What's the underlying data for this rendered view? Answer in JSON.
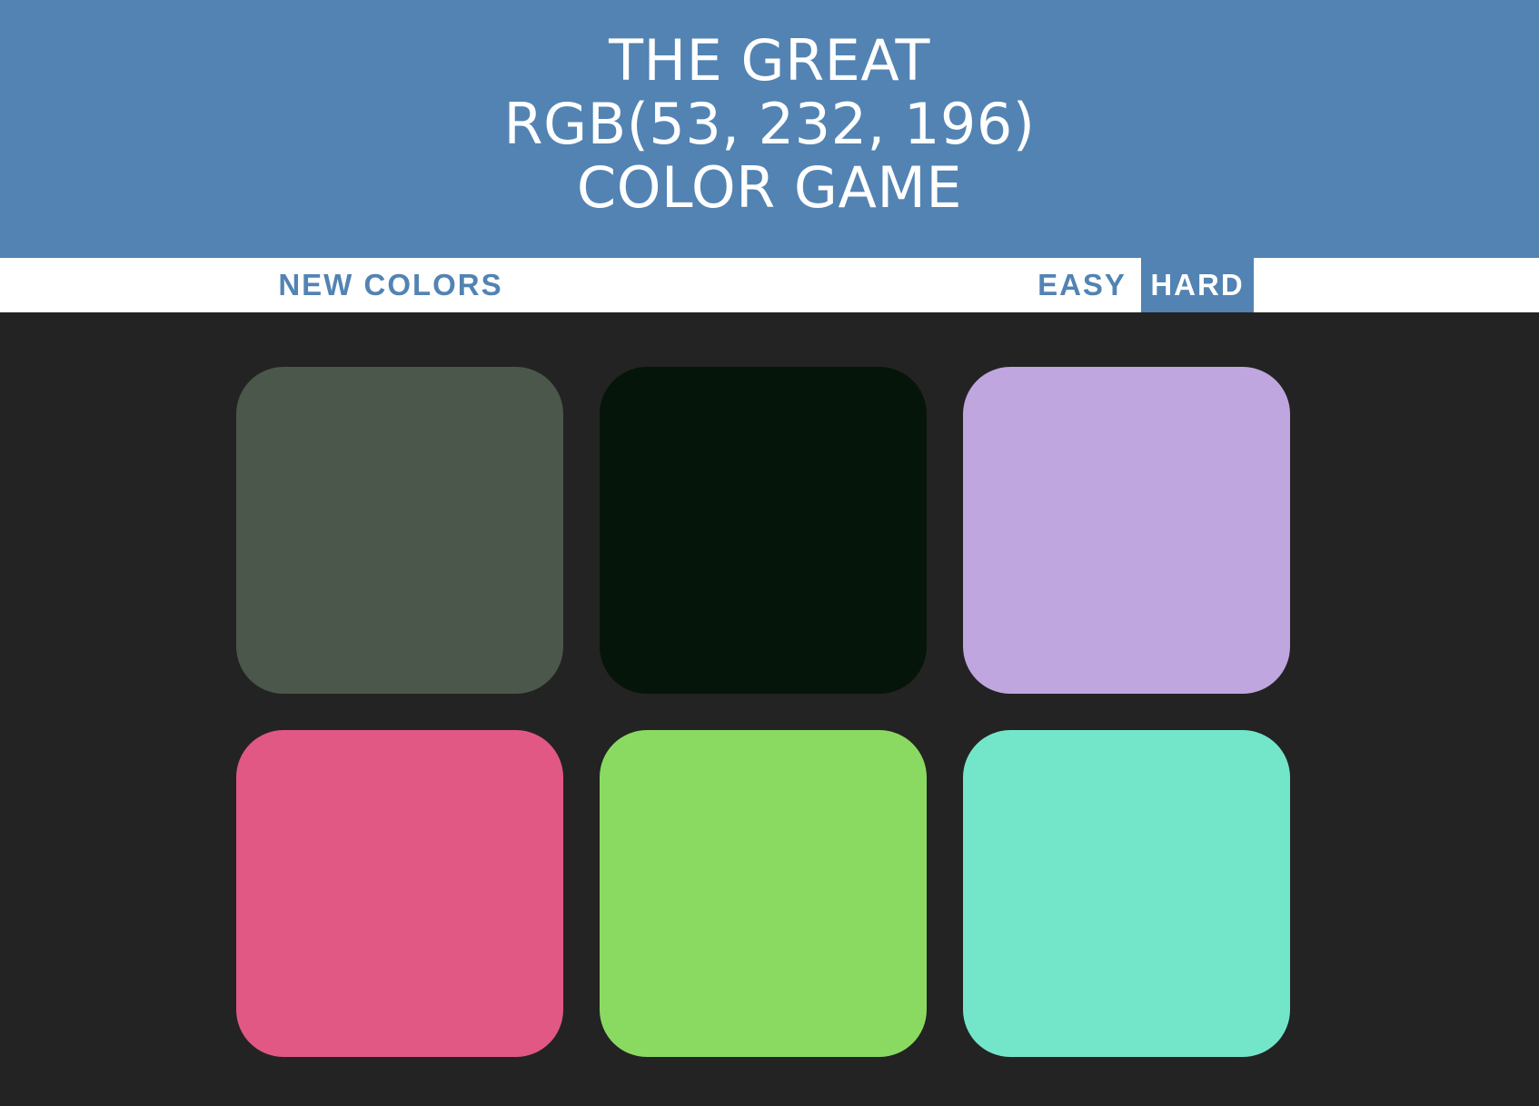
{
  "header": {
    "title_line1": "THE GREAT",
    "title_line2": "RGB(53, 232, 196)",
    "title_line3": "COLOR GAME",
    "background_color": "#5283b3"
  },
  "toolbar": {
    "new_colors_label": "NEW COLORS",
    "easy_label": "EASY",
    "hard_label": "HARD",
    "selected_mode": "HARD"
  },
  "board": {
    "background_color": "#232323",
    "squares": [
      {
        "color": "#4b574a"
      },
      {
        "color": "#061509"
      },
      {
        "color": "#bfa6df"
      },
      {
        "color": "#e15884"
      },
      {
        "color": "#8ada62"
      },
      {
        "color": "#73e6c9"
      }
    ]
  }
}
